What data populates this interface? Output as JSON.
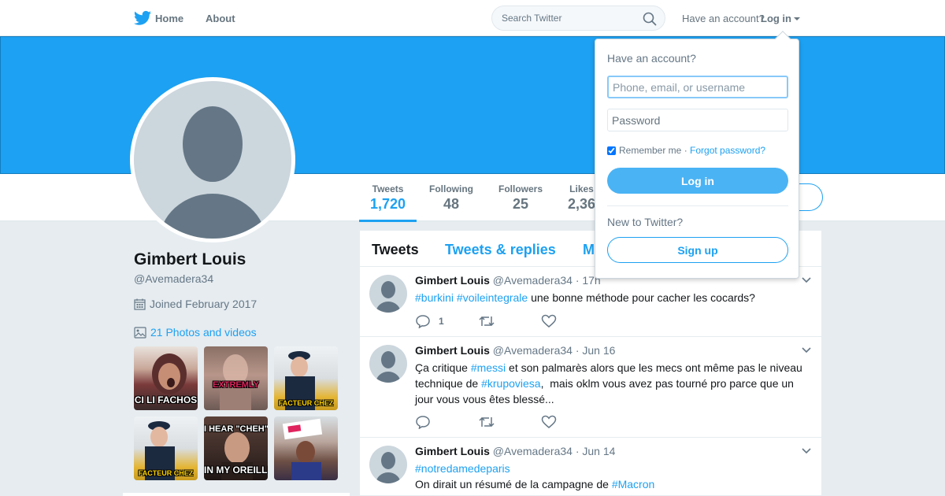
{
  "nav": {
    "home": "Home",
    "about": "About",
    "search_placeholder": "Search Twitter",
    "have_account": "Have an account?",
    "login": "Log in"
  },
  "profile": {
    "name": "Gimbert Louis",
    "handle": "@Avemadera34",
    "joined": "Joined February 2017",
    "photos_link": "21 Photos and videos",
    "stats": [
      {
        "label": "Tweets",
        "value": "1,720"
      },
      {
        "label": "Following",
        "value": "48"
      },
      {
        "label": "Followers",
        "value": "25"
      },
      {
        "label": "Likes",
        "value": "2,36"
      }
    ],
    "thumbnails": [
      {
        "caption": "CI LI FACHOS"
      },
      {
        "caption": "EXTREMLY"
      },
      {
        "caption": "FACTEUR CHEZ"
      },
      {
        "caption": "FACTEUR CHEZ"
      },
      {
        "caption_top": "I HEAR \"CHEH\"",
        "caption": "IN MY OREILLETTE"
      },
      {
        "caption": ""
      }
    ]
  },
  "timeline": {
    "tabs": [
      "Tweets",
      "Tweets & replies",
      "M"
    ],
    "tweets": [
      {
        "name": "Gimbert Louis",
        "handle": "@Avemadera34",
        "time": "· 17h",
        "segments": [
          {
            "text": "#burkini",
            "tag": true
          },
          {
            "text": " ",
            "tag": false
          },
          {
            "text": "#voileintegrale",
            "tag": true
          },
          {
            "text": " une bonne méthode pour cacher les cocards?",
            "tag": false
          }
        ],
        "reply_count": "1"
      },
      {
        "name": "Gimbert Louis",
        "handle": "@Avemadera34",
        "time": "· Jun 16",
        "segments": [
          {
            "text": "Ça critique ",
            "tag": false
          },
          {
            "text": "#messi",
            "tag": true
          },
          {
            "text": " et son palmarès alors que les mecs ont même pas le niveau technique de ",
            "tag": false
          },
          {
            "text": "#krupoviesa",
            "tag": true
          },
          {
            "text": ",  mais oklm vous avez pas tourné pro parce que un jour vous vous êtes blessé...",
            "tag": false
          }
        ],
        "reply_count": ""
      },
      {
        "name": "Gimbert Louis",
        "handle": "@Avemadera34",
        "time": "· Jun 14",
        "segments": [
          {
            "text": "#notredamedeparis",
            "tag": true
          },
          {
            "text": "\nOn dirait un résumé de la campagne de ",
            "tag": false
          },
          {
            "text": "#Macron",
            "tag": true
          }
        ],
        "reply_count": ""
      }
    ]
  },
  "login_dropdown": {
    "title": "Have an account?",
    "username_placeholder": "Phone, email, or username",
    "password_placeholder": "Password",
    "remember_me": "Remember me",
    "separator": " · ",
    "forgot_password": "Forgot password?",
    "login_button": "Log in",
    "new_to_twitter": "New to Twitter?",
    "signup_button": "Sign up"
  },
  "colors": {
    "brand": "#1da1f2",
    "login_button": "#4ab3f4",
    "background": "#e6ecf0"
  },
  "icons": [
    "twitter-bird-icon",
    "search-icon",
    "calendar-icon",
    "photo-icon",
    "reply-icon",
    "retweet-icon",
    "like-icon",
    "chevron-down-icon"
  ]
}
